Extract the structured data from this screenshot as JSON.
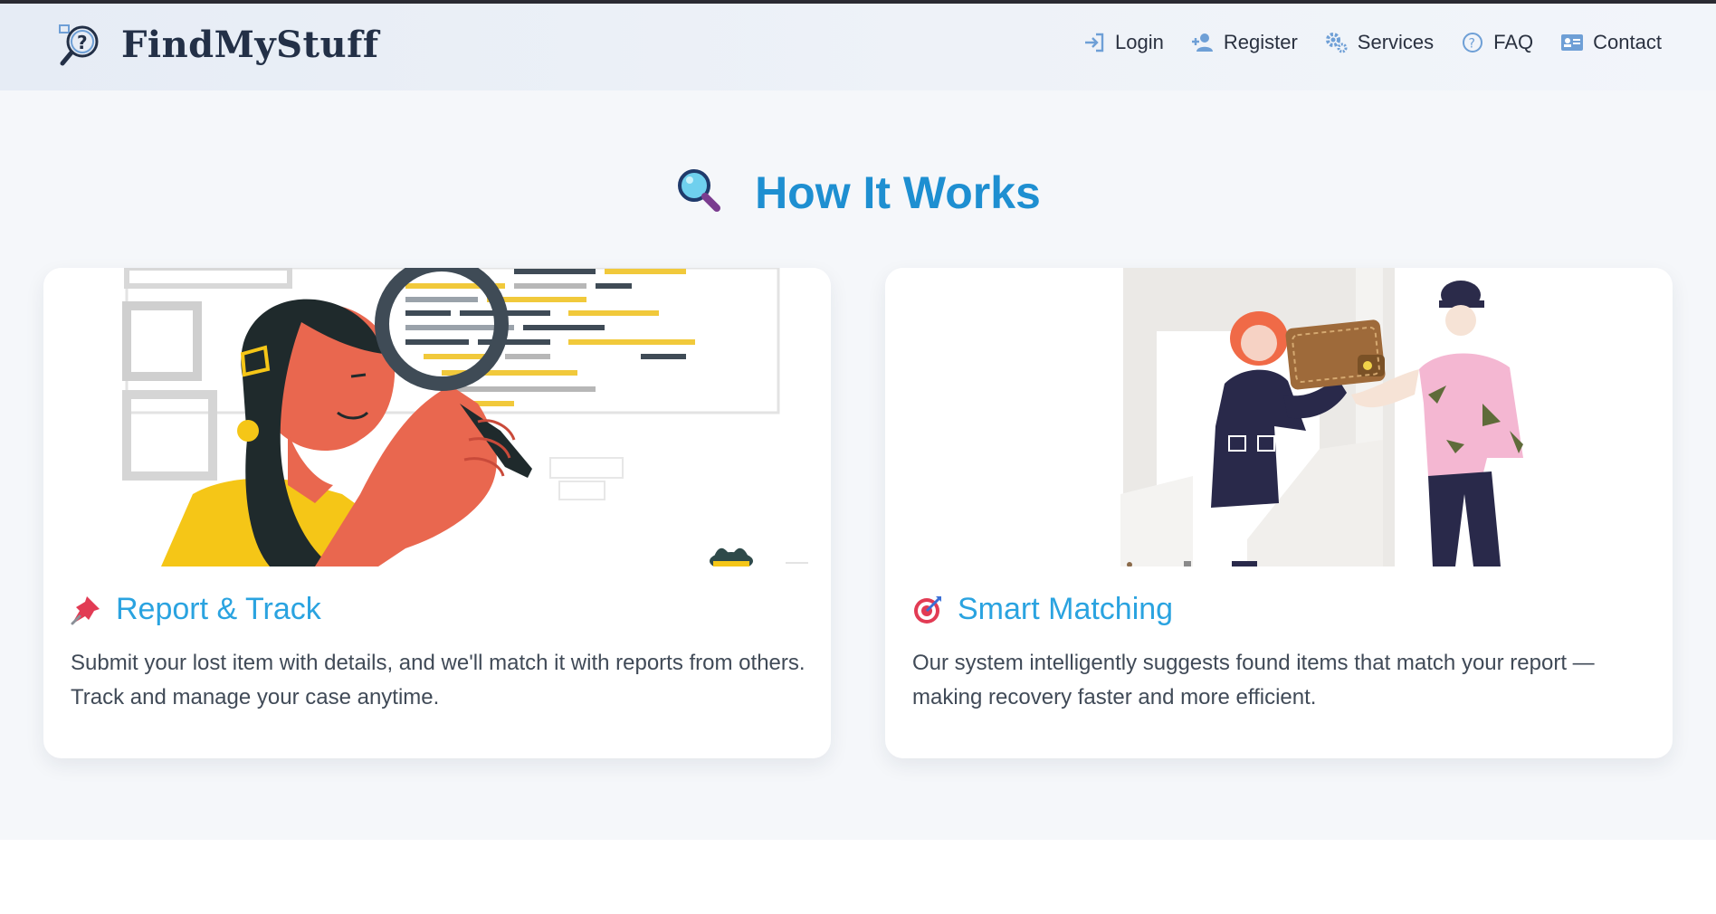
{
  "brand": {
    "name": "FindMyStuff",
    "logo_icon": "magnifier-question-icon"
  },
  "nav": [
    {
      "label": "Login",
      "icon": "login-arrow-icon"
    },
    {
      "label": "Register",
      "icon": "user-plus-icon"
    },
    {
      "label": "Services",
      "icon": "gears-icon"
    },
    {
      "label": "FAQ",
      "icon": "question-circle-icon"
    },
    {
      "label": "Contact",
      "icon": "id-card-icon"
    }
  ],
  "section": {
    "title": "How It Works",
    "icon": "magnifying-glass-emoji"
  },
  "cards": [
    {
      "title": "Report & Track",
      "icon": "pushpin-emoji",
      "image": "woman-with-magnifying-glass-illustration",
      "description": "Submit your lost item with details, and we'll match it with reports from others. Track and manage your case anytime."
    },
    {
      "title": "Smart Matching",
      "icon": "target-emoji",
      "image": "people-handing-wallet-illustration",
      "description": "Our system intelligently suggests found items that match your report — making recovery faster and more efficient."
    }
  ],
  "colors": {
    "brand_text": "#233047",
    "accent_title": "#1e8fd1",
    "card_title": "#2aa3e0",
    "nav_icon": "#6e9fd6",
    "page_bg": "#f5f7fa"
  }
}
